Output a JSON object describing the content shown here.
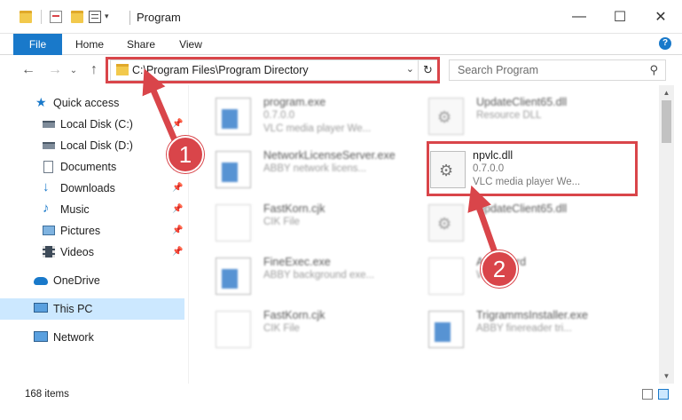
{
  "window": {
    "title": "Program",
    "minimize_glyph": "—",
    "maximize_glyph": "☐",
    "close_glyph": "✕"
  },
  "ribbon": {
    "tabs": [
      "File",
      "Home",
      "Share",
      "View"
    ],
    "help_glyph": "?"
  },
  "navigation": {
    "back_glyph": "←",
    "forward_glyph": "→",
    "recent_glyph": "⌄",
    "up_glyph": "↑",
    "address": "C:\\Program Files\\Program Directory",
    "address_dropdown_glyph": "⌄",
    "refresh_glyph": "↻",
    "search_placeholder": "Search Program",
    "search_glyph": "⚲"
  },
  "sidebar": {
    "items": [
      {
        "label": "Quick access",
        "icon": "star-icon",
        "pinned": false
      },
      {
        "label": "Local Disk (C:)",
        "icon": "drive-icon",
        "pinned": true
      },
      {
        "label": "Local Disk (D:)",
        "icon": "drive-icon",
        "pinned": true
      },
      {
        "label": "Documents",
        "icon": "document-icon",
        "pinned": true
      },
      {
        "label": "Downloads",
        "icon": "download-icon",
        "pinned": true
      },
      {
        "label": "Music",
        "icon": "music-icon",
        "pinned": true
      },
      {
        "label": "Pictures",
        "icon": "pictures-icon",
        "pinned": true
      },
      {
        "label": "Videos",
        "icon": "videos-icon",
        "pinned": true
      },
      {
        "label": "OneDrive",
        "icon": "cloud-icon",
        "pinned": false
      },
      {
        "label": "This PC",
        "icon": "computer-icon",
        "pinned": false,
        "selected": true
      },
      {
        "label": "Network",
        "icon": "network-icon",
        "pinned": false
      }
    ],
    "pin_glyph": "📌"
  },
  "files": [
    {
      "name": "program.exe",
      "line2": "0.7.0.0",
      "line3": "VLC media player We...",
      "icon": "exe-icon"
    },
    {
      "name": "UpdateClient65.dll",
      "line2": "Resource DLL",
      "line3": "",
      "icon": "dll-icon"
    },
    {
      "name": "NetworkLicenseServer.exe",
      "line2": "ABBY network licens...",
      "line3": "",
      "icon": "exe-icon"
    },
    {
      "name": "npvlc.dll",
      "line2": "0.7.0.0",
      "line3": "VLC media player We...",
      "icon": "dll-icon",
      "highlighted": true
    },
    {
      "name": "FastKorn.cjk",
      "line2": "CIK File",
      "line3": "",
      "icon": "doc-icon"
    },
    {
      "name": "UpdateClient65.dll",
      "line2": "",
      "line3": "",
      "icon": "dll-icon"
    },
    {
      "name": "FineExec.exe",
      "line2": "ABBY background exe...",
      "line3": "",
      "icon": "exe-icon"
    },
    {
      "name": "AreaWord",
      "line2": "W...",
      "line3": "",
      "icon": "doc-icon"
    },
    {
      "name": "FastKorn.cjk",
      "line2": "CIK File",
      "line3": "",
      "icon": "doc-icon"
    },
    {
      "name": "TrigrammsInstaller.exe",
      "line2": "ABBY finereader tri...",
      "line3": "",
      "icon": "exe-icon"
    }
  ],
  "status": {
    "item_count": "168 items"
  },
  "annotations": {
    "step1": "1",
    "step2": "2",
    "color": "#d9454a"
  },
  "colors": {
    "accent": "#1979ca",
    "selected_bg": "#cce8ff",
    "highlight": "#d9454a"
  }
}
